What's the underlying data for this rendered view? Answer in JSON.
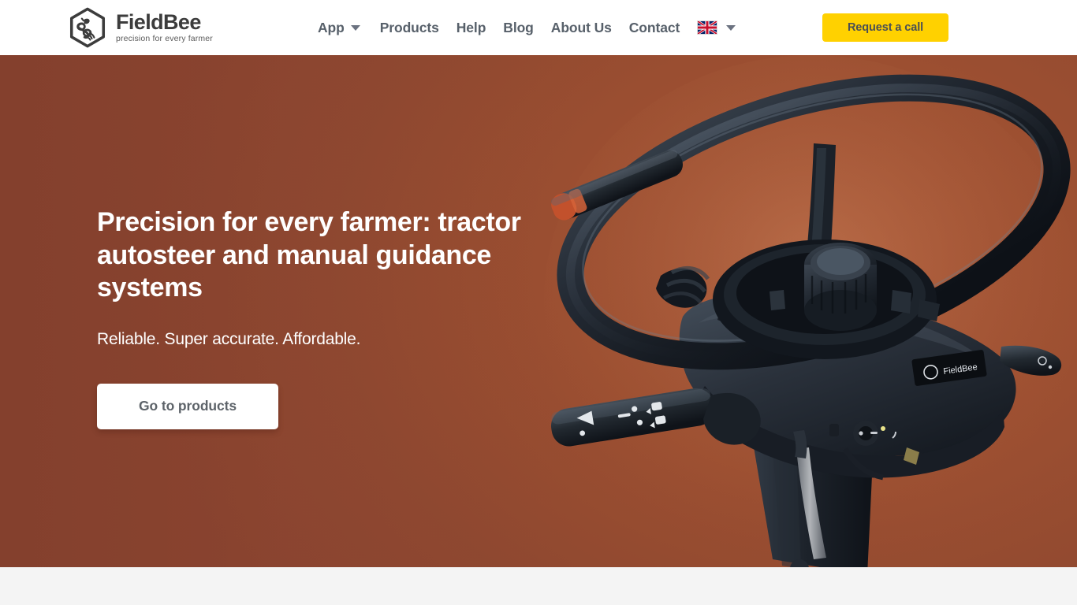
{
  "header": {
    "logo": {
      "name": "FieldBee",
      "tagline": "precision for every farmer",
      "icon": "hexagon-bee-logo-icon"
    },
    "nav": [
      {
        "label": "App",
        "has_dropdown": true,
        "icon": "chevron-down-icon"
      },
      {
        "label": "Products",
        "has_dropdown": false
      },
      {
        "label": "Help",
        "has_dropdown": false
      },
      {
        "label": "Blog",
        "has_dropdown": false
      },
      {
        "label": "About Us",
        "has_dropdown": false
      },
      {
        "label": "Contact",
        "has_dropdown": false
      }
    ],
    "language": {
      "current": "EN",
      "flag_icon": "uk-flag-icon",
      "caret_icon": "chevron-down-icon"
    },
    "cta": {
      "label": "Request a call",
      "bg_color": "#ffd100",
      "text_color": "#4a4f55"
    }
  },
  "hero": {
    "title": "Precision for every farmer: tractor autosteer and manual guidance systems",
    "subtitle": "Reliable. Super accurate. Affordable.",
    "button": {
      "label": "Go to products",
      "bg_color": "#ffffff",
      "text_color": "#5d6369"
    },
    "background": {
      "color_left": "#8e4530",
      "color_right": "#a05330"
    },
    "image": {
      "name": "tractor-steering-wheel-with-fieldbee-autosteer-motor",
      "badge_text": "FieldBee"
    }
  },
  "page": {
    "section_below_bg": "#f4f4f4"
  }
}
